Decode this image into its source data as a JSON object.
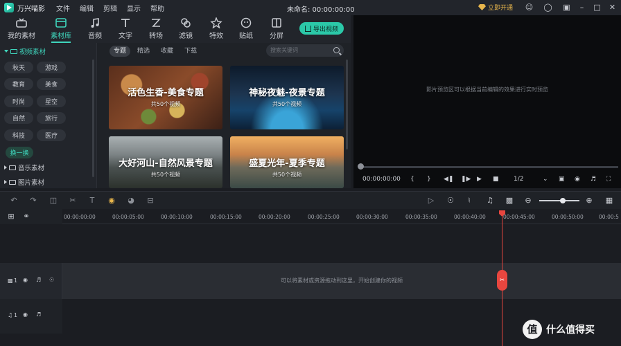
{
  "titlebar": {
    "app_name": "万兴喵影",
    "menus": [
      "文件",
      "编辑",
      "剪辑",
      "显示",
      "帮助"
    ],
    "document_title": "未命名: 00:00:00:00",
    "open_vip": "立即开通"
  },
  "toolbar": {
    "tools": [
      "我的素材",
      "素材库",
      "音频",
      "文字",
      "转场",
      "滤镜",
      "特效",
      "贴纸",
      "分屏"
    ],
    "active_tool": "素材库",
    "export_label": "导出视频"
  },
  "left_panel": {
    "video_section": "视频素材",
    "tags": [
      "秋天",
      "游戏",
      "教育",
      "美食",
      "时尚",
      "星空",
      "自然",
      "旅行",
      "科技",
      "医疗"
    ],
    "change_button": "换一换",
    "music_section": "音乐素材",
    "image_section": "图片素材"
  },
  "browser": {
    "tabs": [
      "专题",
      "精选",
      "收藏",
      "下载"
    ],
    "active_tab": "专题",
    "search_placeholder": "搜索关键词",
    "cards": [
      {
        "title": "活色生香-美食专题",
        "count": "共50个视频"
      },
      {
        "title": "神秘夜魅-夜景专题",
        "count": "共50个视频"
      },
      {
        "title": "大好河山-自然风景专题",
        "count": "共50个视频"
      },
      {
        "title": "盛夏光年-夏季专题",
        "count": "共50个视频"
      }
    ]
  },
  "preview": {
    "hint": "影片预览区可以根据当前编辑的效果进行实时预览",
    "timecode": "00:00:00:00",
    "zoom": "1/2"
  },
  "ruler": {
    "ticks": [
      "00:00:00:00",
      "00:00:05:00",
      "00:00:10:00",
      "00:00:15:00",
      "00:00:20:00",
      "00:00:25:00",
      "00:00:30:00",
      "00:00:35:00",
      "00:00:40:00",
      "00:00:45:00",
      "00:00:50:00",
      "00:00:5"
    ]
  },
  "timeline": {
    "video_track_index": "1",
    "audio_track_index": "1",
    "drop_hint": "可以将素材或资源拖动到这里，开始创建你的视频"
  },
  "watermark": {
    "symbol": "值",
    "text": "什么值得买"
  },
  "colors": {
    "accent": "#3fd6bd",
    "playhead": "#e8463f",
    "vip": "#e8b64c"
  }
}
